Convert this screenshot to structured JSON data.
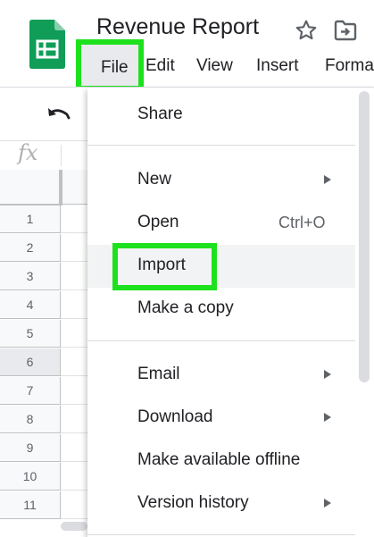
{
  "doc": {
    "title": "Revenue Report"
  },
  "header": {
    "app_icon": "sheets-logo-icon",
    "star_icon": "star-icon",
    "move_icon": "move-to-folder-icon"
  },
  "menubar": {
    "items": [
      "File",
      "Edit",
      "View",
      "Insert",
      "Forma"
    ]
  },
  "toolbar": {
    "undo_icon": "undo-icon"
  },
  "formula_bar": {
    "fx": "fx"
  },
  "grid": {
    "rows": [
      "1",
      "2",
      "3",
      "4",
      "5",
      "6",
      "7",
      "8",
      "9",
      "10",
      "11"
    ],
    "selected_row": "6"
  },
  "file_menu": {
    "items": [
      {
        "label": "Share"
      },
      {
        "label": "New",
        "submenu": true
      },
      {
        "label": "Open",
        "shortcut": "Ctrl+O"
      },
      {
        "label": "Import",
        "highlighted": true
      },
      {
        "label": "Make a copy"
      },
      {
        "label": "Email",
        "submenu": true
      },
      {
        "label": "Download",
        "submenu": true
      },
      {
        "label": "Make available offline"
      },
      {
        "label": "Version history",
        "submenu": true
      }
    ]
  },
  "colors": {
    "highlight": "#1ee11e",
    "sheets_green": "#0f9d58",
    "text": "#202124",
    "hover": "#f1f3f4"
  }
}
